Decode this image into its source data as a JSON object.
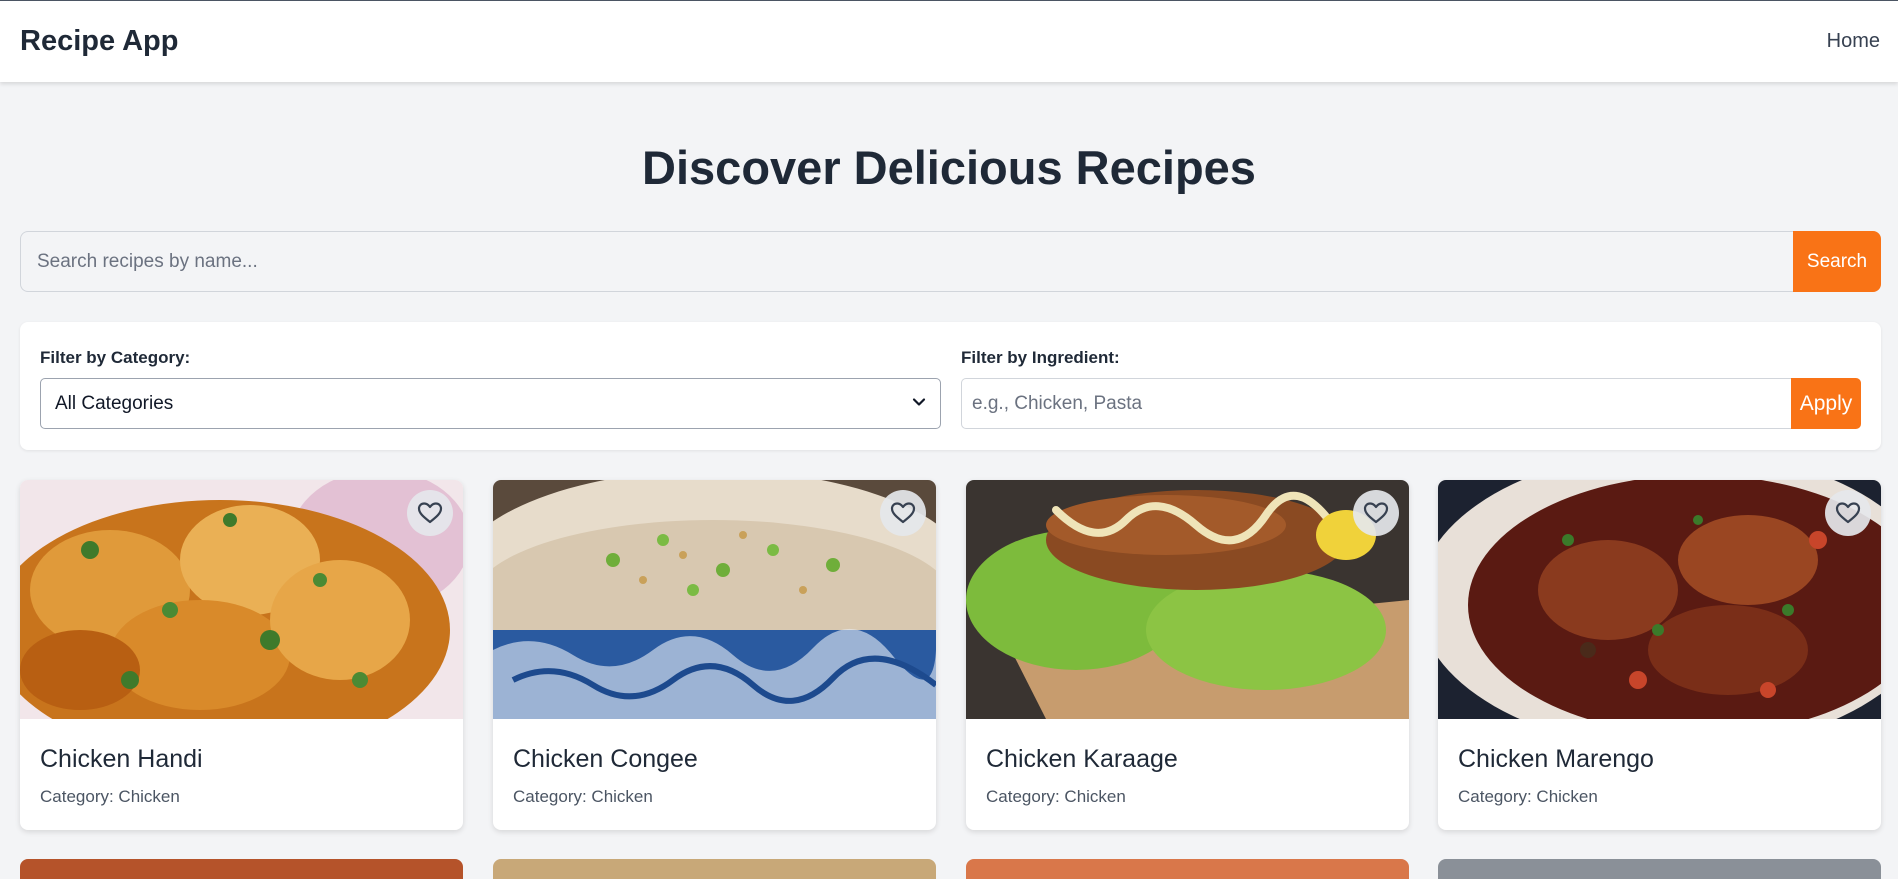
{
  "header": {
    "app_title": "Recipe App",
    "nav": {
      "home": "Home"
    }
  },
  "hero": {
    "title": "Discover Delicious Recipes"
  },
  "search": {
    "placeholder": "Search recipes by name...",
    "button": "Search"
  },
  "filters": {
    "category_label": "Filter by Category:",
    "category_selected": "All Categories",
    "ingredient_label": "Filter by Ingredient:",
    "ingredient_placeholder": "e.g., Chicken, Pasta",
    "apply_button": "Apply"
  },
  "colors": {
    "accent": "#f97316",
    "background": "#f3f4f6",
    "text": "#1f2937"
  },
  "recipes": [
    {
      "name": "Chicken Handi",
      "category": "Category: Chicken",
      "favorite_icon": "heart-outline-icon"
    },
    {
      "name": "Chicken Congee",
      "category": "Category: Chicken",
      "favorite_icon": "heart-outline-icon"
    },
    {
      "name": "Chicken Karaage",
      "category": "Category: Chicken",
      "favorite_icon": "heart-outline-icon"
    },
    {
      "name": "Chicken Marengo",
      "category": "Category: Chicken",
      "favorite_icon": "heart-outline-icon"
    }
  ]
}
